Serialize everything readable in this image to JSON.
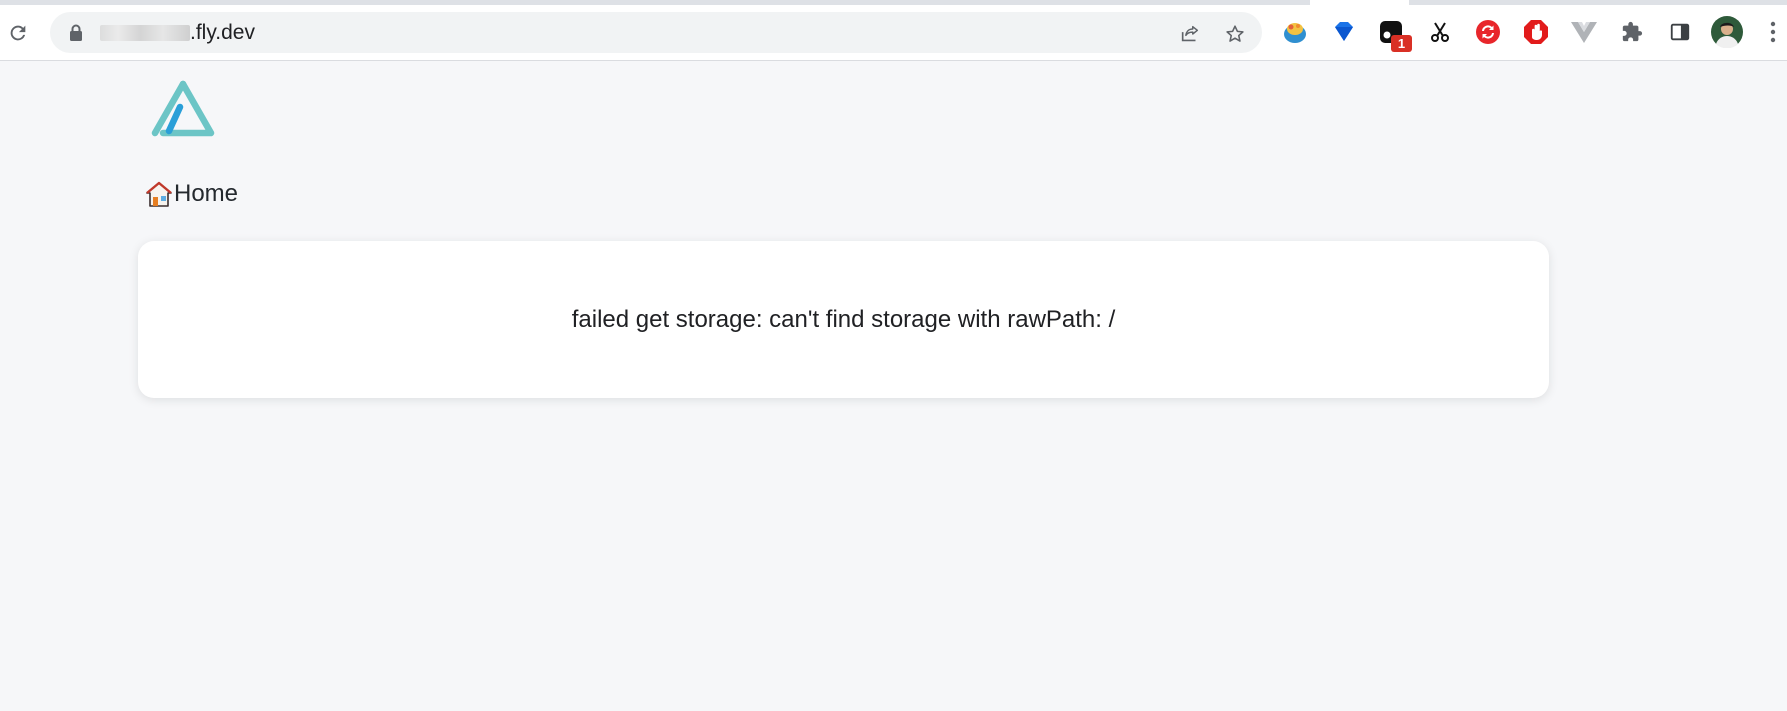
{
  "browser": {
    "url_host": ".fly.dev",
    "extension_badge_count": "1",
    "icons": {
      "reload": "reload-icon",
      "lock": "lock-icon",
      "share": "share-icon",
      "bookmark": "star-icon",
      "extensions": "puzzle-icon",
      "side_panel": "side-panel-icon",
      "profile": "avatar"
    }
  },
  "page": {
    "breadcrumb": {
      "icon": "house-icon",
      "label": "Home"
    },
    "message": "failed get storage: can't find storage with rawPath: /"
  },
  "colors": {
    "page_background": "#f6f7f9",
    "card_background": "#ffffff",
    "logo_teal": "#6cc5c6",
    "logo_blue": "#2a9fd8",
    "badge_red": "#d93025"
  }
}
